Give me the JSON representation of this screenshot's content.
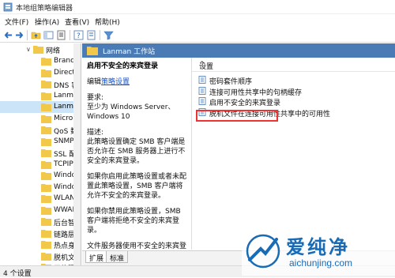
{
  "window": {
    "title": "本地组策略编辑器"
  },
  "menu": [
    {
      "label": "文件(F)"
    },
    {
      "label": "操作(A)"
    },
    {
      "label": "查看(V)"
    },
    {
      "label": "帮助(H)"
    }
  ],
  "toolbar": {
    "icons": [
      "back-arrow-icon",
      "forward-arrow-icon",
      "up-folder-icon",
      "show-hide-tree-icon",
      "export-list-icon",
      "help-icon",
      "properties-icon",
      "filter-icon"
    ]
  },
  "tree": {
    "parent": "网络",
    "items": [
      {
        "label": "Brancl"
      },
      {
        "label": "Direct"
      },
      {
        "label": "DNS 客"
      },
      {
        "label": "Lanma"
      },
      {
        "label": "Lanma",
        "selected": true
      },
      {
        "label": "Micro"
      },
      {
        "label": "QoS 数"
      },
      {
        "label": "SNMP"
      },
      {
        "label": "SSL 配"
      },
      {
        "label": "TCPIP"
      },
      {
        "label": "Windo"
      },
      {
        "label": "Windo"
      },
      {
        "label": "WLAN"
      },
      {
        "label": "WWAI"
      },
      {
        "label": "后台智"
      },
      {
        "label": "链路层"
      },
      {
        "label": "热点身"
      },
      {
        "label": "脱机文"
      },
      {
        "label": "网络隔"
      }
    ]
  },
  "panel": {
    "header": "Lanman 工作站",
    "desc_title": "启用不安全的来宾登录",
    "edit_prefix": "编辑",
    "edit_link": "策略设置",
    "req_label": "要求:",
    "req_text": "至少为 Windows Server、Windows 10",
    "desc_label": "描述:",
    "desc_p1": "此策略设置确定 SMB 客户端是否允许在 SMB 服务器上进行不安全的来宾登录。",
    "desc_p2": "如果你启用此策略设置或者未配置此策略设置，SMB 客户端将允许不安全的来宾登录。",
    "desc_p3": "如果你禁用此策略设置，SMB 客户端将拒绝不安全的来宾登录。",
    "desc_p4": "文件服务器使用不安全的来宾登录允许在未经身份验证的情况下访问共享文件夹"
  },
  "list": {
    "column": "设置",
    "items": [
      {
        "label": "密码套件顺序"
      },
      {
        "label": "连接可用性共享中的句柄缓存"
      },
      {
        "label": "启用不安全的来宾登录",
        "highlighted": true
      },
      {
        "label": "脱机文件在连接可用性共享中的可用性"
      }
    ]
  },
  "tabs": [
    {
      "label": "扩展"
    },
    {
      "label": "标准"
    }
  ],
  "status": {
    "text": "4 个设置"
  },
  "watermark": {
    "brand": "爱纯净",
    "url": "aichunjing.com"
  },
  "colors": {
    "header_band": "#4a7bb5",
    "highlight_border": "#e33333",
    "link": "#1a56c7",
    "selection": "#cce4f7"
  }
}
